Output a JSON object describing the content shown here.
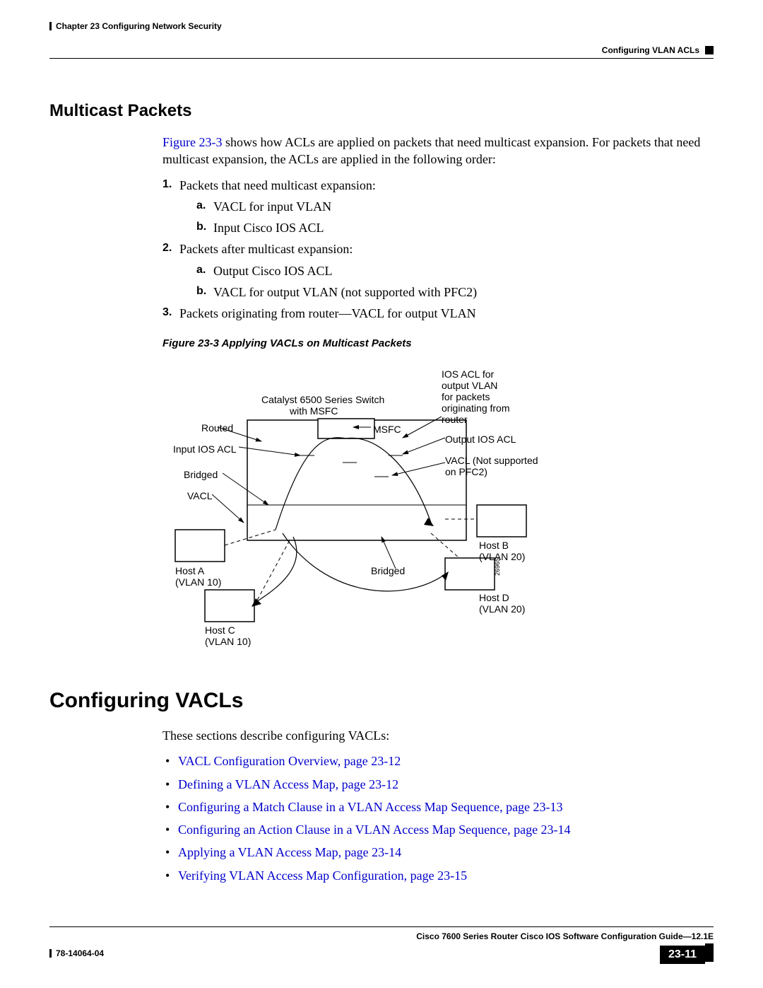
{
  "header": {
    "chapter": "Chapter 23    Configuring Network Security",
    "section": "Configuring VLAN ACLs"
  },
  "s1": {
    "title": "Multicast Packets",
    "figref": "Figure 23-3",
    "intro_rest": " shows how ACLs are applied on packets that need multicast expansion. For packets that need multicast expansion, the ACLs are applied in the following order:",
    "item1": "Packets that need multicast expansion:",
    "item1a": "VACL for input VLAN",
    "item1b": "Input Cisco IOS ACL",
    "item2": "Packets after multicast expansion:",
    "item2a": "Output Cisco IOS ACL",
    "item2b": "VACL for output VLAN (not supported with PFC2)",
    "item3": "Packets originating from router—VACL for output VLAN",
    "figcaption": "Figure 23-3   Applying VACLs on Multicast Packets"
  },
  "diagram": {
    "switch": "Catalyst 6500 Series Switch",
    "withmsfc": "with MSFC",
    "routed": "Routed",
    "input_ios": "Input IOS ACL",
    "bridged": "Bridged",
    "vacl": "VACL",
    "hosta": "Host A",
    "vlan10a": "(VLAN 10)",
    "hostc": "Host C",
    "vlan10c": "(VLAN 10)",
    "msfc": "MSFC",
    "bridged2": "Bridged",
    "ios_out_text1": "IOS ACL for",
    "ios_out_text2": "output VLAN",
    "ios_out_text3": "for packets",
    "ios_out_text4": "originating from",
    "ios_out_text5": "router",
    "output_ios": "Output IOS ACL",
    "vacl_ns1": "VACL (Not supported",
    "vacl_ns2": "on PFC2)",
    "hostb": "Host B",
    "vlan20b": "(VLAN 20)",
    "hostd": "Host D",
    "vlan20d": "(VLAN 20)",
    "figid": "26965"
  },
  "s2": {
    "title": "Configuring VACLs",
    "intro": "These sections describe configuring VACLs:",
    "b1": "VACL Configuration Overview, page 23-12",
    "b2": "Defining a VLAN Access Map, page 23-12",
    "b3": "Configuring a Match Clause in a VLAN Access Map Sequence, page 23-13",
    "b4": "Configuring an Action Clause in a VLAN Access Map Sequence, page 23-14",
    "b5": "Applying a VLAN Access Map, page 23-14",
    "b6": "Verifying VLAN Access Map Configuration, page 23-15"
  },
  "footer": {
    "guide": "Cisco 7600 Series Router Cisco IOS Software Configuration Guide—12.1E",
    "docnum": "78-14064-04",
    "pagenum": "23-11"
  }
}
